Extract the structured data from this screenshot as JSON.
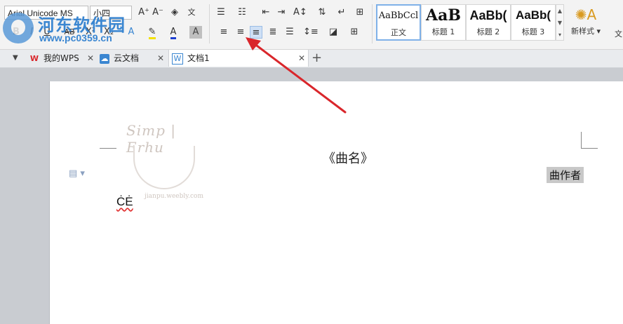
{
  "ribbon": {
    "font_name": "Arial Unicode MS",
    "font_size": "小四",
    "styles": [
      {
        "sample": "AaBbCcl",
        "name": "正文",
        "selected": true
      },
      {
        "sample": "AaB",
        "name": "标题 1",
        "selected": false
      },
      {
        "sample": "AaBb(",
        "name": "标题 2",
        "selected": false
      },
      {
        "sample": "AaBb(",
        "name": "标题 3",
        "selected": false
      }
    ],
    "new_style_label": "新样式 ▾",
    "cut_edge_label": "文"
  },
  "tabs": [
    {
      "label": "我的WPS",
      "icon": "wps-logo-icon"
    },
    {
      "label": "云文档",
      "icon": "cloud-doc-icon"
    },
    {
      "label": "文档1",
      "icon": "document-icon",
      "active": true
    }
  ],
  "document": {
    "title": "《曲名》",
    "author": "曲作者",
    "lyric_line": "ĊĖ"
  },
  "watermark": {
    "title": "Simp | Erhu",
    "subtitle": "jianpu.weebly.com"
  },
  "site_logo": {
    "name": "河东软件园",
    "url": "www.pc0359.cn"
  },
  "colors": {
    "accent": "#3a86d1",
    "arrow": "#d9262b",
    "highlight": "#c8c8c8"
  }
}
